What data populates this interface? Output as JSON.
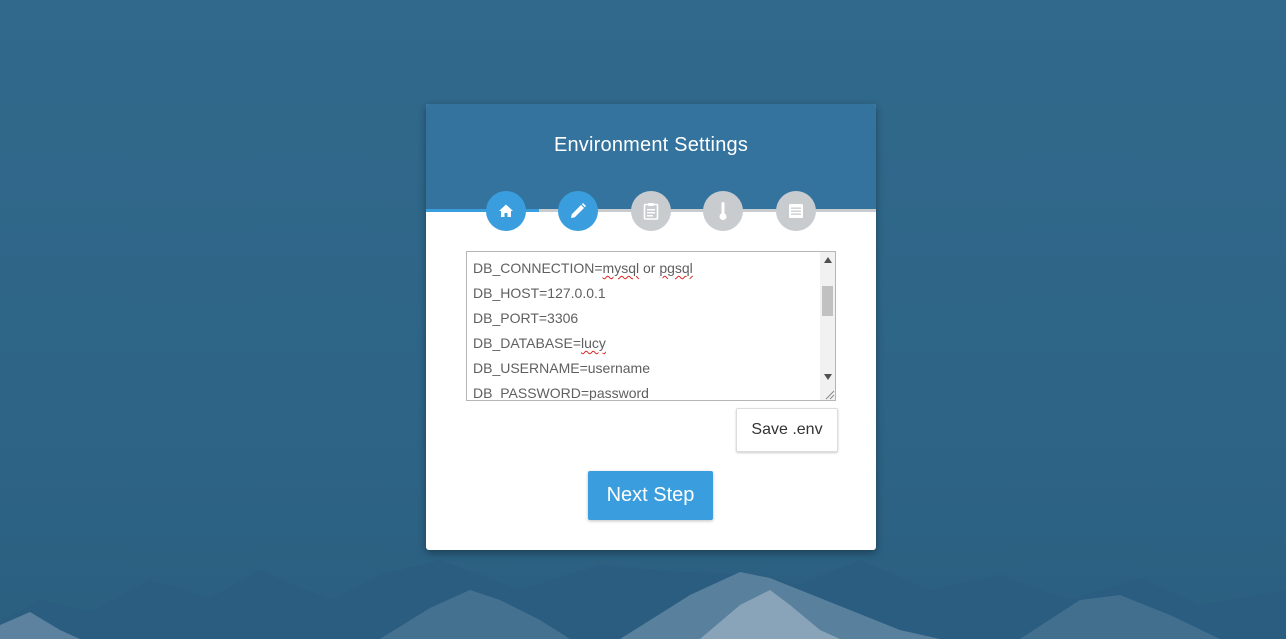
{
  "page": {
    "title": "Environment Settings"
  },
  "colors": {
    "background": "#31698c",
    "header": "#33739e",
    "accent": "#3a9ede",
    "inactive_step": "#c8ccce",
    "text": "#5f5f5f"
  },
  "steps": {
    "progress": 0.25,
    "items": [
      {
        "icon": "home-icon",
        "state": "completed"
      },
      {
        "icon": "pencil-icon",
        "state": "active"
      },
      {
        "icon": "clipboard-icon",
        "state": "inactive"
      },
      {
        "icon": "thermometer-icon",
        "state": "inactive"
      },
      {
        "icon": "list-icon",
        "state": "inactive"
      }
    ]
  },
  "env": {
    "lines": [
      {
        "key": "DB_CONNECTION=",
        "value_parts": [
          "mysql",
          " or ",
          "pgsql"
        ]
      },
      {
        "text": "DB_HOST=127.0.0.1"
      },
      {
        "text": "DB_PORT=3306"
      },
      {
        "key": "DB_DATABASE=",
        "value": "lucy"
      },
      {
        "text": "DB_USERNAME=username"
      },
      {
        "text": "DB_PASSWORD=password"
      }
    ]
  },
  "buttons": {
    "save_label": "Save .env",
    "next_label": "Next Step"
  }
}
